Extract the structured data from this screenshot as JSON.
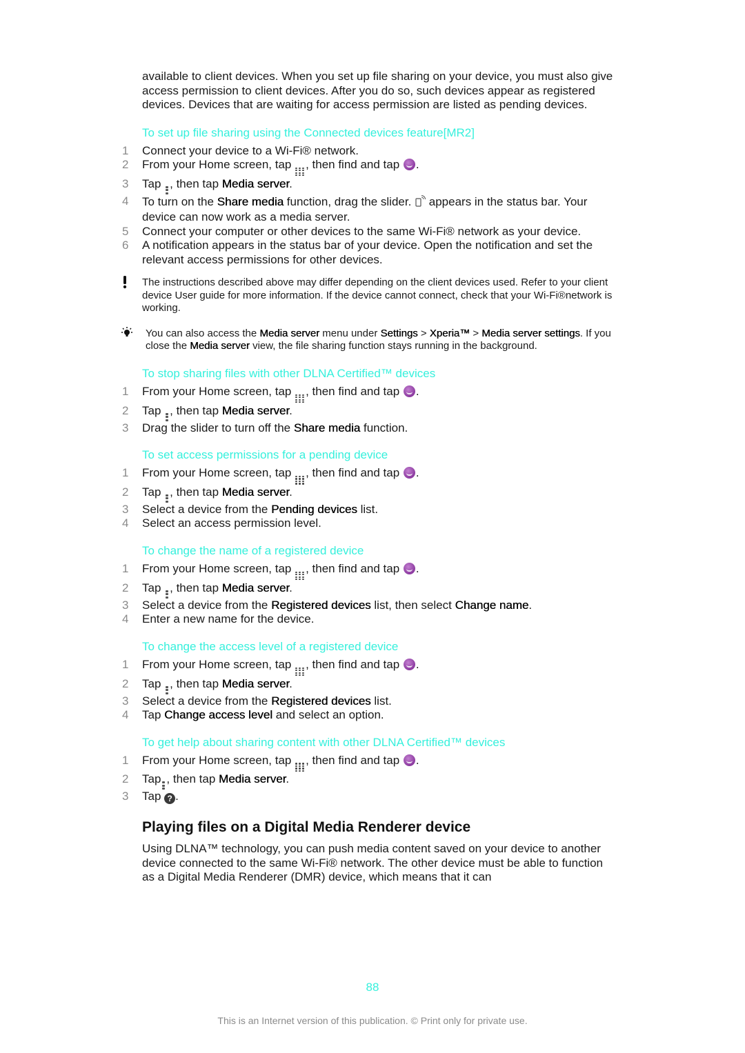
{
  "intro": "available to client devices. When you set up file sharing on your device, you must also give access permission to client devices. After you do so, such devices appear as registered devices. Devices that are waiting for access permission are listed as pending devices.",
  "sections": [
    {
      "title": "To set up file sharing using the Connected devices feature[MR2]",
      "steps": [
        {
          "n": "1",
          "parts": [
            {
              "t": "Connect your device to a Wi-Fi® network."
            }
          ]
        },
        {
          "n": "2",
          "parts": [
            {
              "t": "From your Home screen, tap "
            },
            {
              "icon": "apps-grid-icon"
            },
            {
              "t": ", then find and tap "
            },
            {
              "icon": "walkman-app-icon"
            },
            {
              "t": "."
            }
          ]
        },
        {
          "n": "3",
          "parts": [
            {
              "t": "Tap "
            },
            {
              "icon": "menu-icon"
            },
            {
              "t": ", then tap "
            },
            {
              "b": "Media server"
            },
            {
              "t": "."
            }
          ]
        },
        {
          "n": "4",
          "parts": [
            {
              "t": "To turn on the "
            },
            {
              "b": "Share media"
            },
            {
              "t": " function, drag the slider. "
            },
            {
              "icon": "media-server-status-icon"
            },
            {
              "t": " appears in the status bar. Your device can now work as a media server."
            }
          ]
        },
        {
          "n": "5",
          "parts": [
            {
              "t": "Connect your computer or other devices to the same Wi-Fi® network as your device."
            }
          ]
        },
        {
          "n": "6",
          "parts": [
            {
              "t": "A notification appears in the status bar of your device. Open the notification and set the relevant access permissions for other devices."
            }
          ]
        }
      ]
    }
  ],
  "notes": {
    "warning": "The instructions described above may differ depending on the client devices used. Refer to your client device User guide for more information. If the device cannot connect, check that your Wi-Fi®network is working.",
    "tip_parts": [
      {
        "t": "You can also access the "
      },
      {
        "b": "Media server"
      },
      {
        "t": " menu under "
      },
      {
        "b": "Settings"
      },
      {
        "t": " > "
      },
      {
        "b": "Xperia™"
      },
      {
        "t": " > "
      },
      {
        "b": "Media server settings"
      },
      {
        "t": ". If you close the "
      },
      {
        "b": "Media server"
      },
      {
        "t": " view, the file sharing function stays running in the background."
      }
    ]
  },
  "sections2": [
    {
      "title": "To stop sharing files with other DLNA Certified™ devices",
      "steps": [
        {
          "n": "1",
          "parts": [
            {
              "t": "From your Home screen, tap "
            },
            {
              "icon": "apps-grid-icon"
            },
            {
              "t": ", then find and tap "
            },
            {
              "icon": "walkman-app-icon"
            },
            {
              "t": "."
            }
          ]
        },
        {
          "n": "2",
          "parts": [
            {
              "t": "Tap "
            },
            {
              "icon": "menu-icon"
            },
            {
              "t": ", then tap "
            },
            {
              "b": "Media server"
            },
            {
              "t": "."
            }
          ]
        },
        {
          "n": "3",
          "parts": [
            {
              "t": "Drag the slider to turn off the "
            },
            {
              "b": "Share media"
            },
            {
              "t": " function."
            }
          ]
        }
      ]
    },
    {
      "title": "To set access permissions for a pending device",
      "steps": [
        {
          "n": "1",
          "parts": [
            {
              "t": "From your Home screen, tap "
            },
            {
              "icon": "apps-grid-icon"
            },
            {
              "t": ", then find and tap "
            },
            {
              "icon": "walkman-app-icon"
            },
            {
              "t": "."
            }
          ]
        },
        {
          "n": "2",
          "parts": [
            {
              "t": "Tap "
            },
            {
              "icon": "menu-icon"
            },
            {
              "t": ", then tap "
            },
            {
              "b": "Media server"
            },
            {
              "t": "."
            }
          ]
        },
        {
          "n": "3",
          "parts": [
            {
              "t": "Select a device from the "
            },
            {
              "b": "Pending devices"
            },
            {
              "t": " list."
            }
          ]
        },
        {
          "n": "4",
          "parts": [
            {
              "t": "Select an access permission level."
            }
          ]
        }
      ]
    },
    {
      "title": "To change the name of a registered device",
      "steps": [
        {
          "n": "1",
          "parts": [
            {
              "t": "From your Home screen, tap "
            },
            {
              "icon": "apps-grid-icon"
            },
            {
              "t": ", then find and tap "
            },
            {
              "icon": "walkman-app-icon"
            },
            {
              "t": "."
            }
          ]
        },
        {
          "n": "2",
          "parts": [
            {
              "t": "Tap "
            },
            {
              "icon": "menu-icon"
            },
            {
              "t": ", then tap "
            },
            {
              "b": "Media server"
            },
            {
              "t": "."
            }
          ]
        },
        {
          "n": "3",
          "parts": [
            {
              "t": "Select a device from the "
            },
            {
              "b": "Registered devices"
            },
            {
              "t": " list, then select "
            },
            {
              "b": "Change name"
            },
            {
              "t": "."
            }
          ]
        },
        {
          "n": "4",
          "parts": [
            {
              "t": "Enter a new name for the device."
            }
          ]
        }
      ]
    },
    {
      "title": "To change the access level of a registered device",
      "steps": [
        {
          "n": "1",
          "parts": [
            {
              "t": "From your Home screen, tap "
            },
            {
              "icon": "apps-grid-icon"
            },
            {
              "t": ", then find and tap "
            },
            {
              "icon": "walkman-app-icon"
            },
            {
              "t": "."
            }
          ]
        },
        {
          "n": "2",
          "parts": [
            {
              "t": "Tap "
            },
            {
              "icon": "menu-icon"
            },
            {
              "t": ", then tap "
            },
            {
              "b": "Media server"
            },
            {
              "t": "."
            }
          ]
        },
        {
          "n": "3",
          "parts": [
            {
              "t": "Select a device from the "
            },
            {
              "b": "Registered devices"
            },
            {
              "t": " list."
            }
          ]
        },
        {
          "n": "4",
          "parts": [
            {
              "t": "Tap "
            },
            {
              "b": "Change access level"
            },
            {
              "t": " and select an option."
            }
          ]
        }
      ]
    },
    {
      "title": "To get help about sharing content with other DLNA Certified™ devices",
      "steps": [
        {
          "n": "1",
          "parts": [
            {
              "t": "From your Home screen, tap "
            },
            {
              "icon": "apps-grid-icon"
            },
            {
              "t": ", then find and tap "
            },
            {
              "icon": "walkman-app-icon"
            },
            {
              "t": "."
            }
          ]
        },
        {
          "n": "2",
          "parts": [
            {
              "t": "Tap"
            },
            {
              "icon": "menu-icon"
            },
            {
              "t": ", then tap "
            },
            {
              "b": "Media server"
            },
            {
              "t": "."
            }
          ]
        },
        {
          "n": "3",
          "parts": [
            {
              "t": "Tap "
            },
            {
              "icon": "help-icon"
            },
            {
              "t": "."
            }
          ]
        }
      ]
    }
  ],
  "heading": "Playing files on a Digital Media Renderer device",
  "closing": "Using DLNA™ technology, you can push media content saved on your device to another device connected to the same Wi-Fi® network. The other device must be able to function as a Digital Media Renderer (DMR) device, which means that it can",
  "page_number": "88",
  "footer": "This is an Internet version of this publication. © Print only for private use.",
  "colors": {
    "accent": "#35f0dc",
    "text": "#1a1a1a",
    "step_number": "#8a8a8a"
  }
}
